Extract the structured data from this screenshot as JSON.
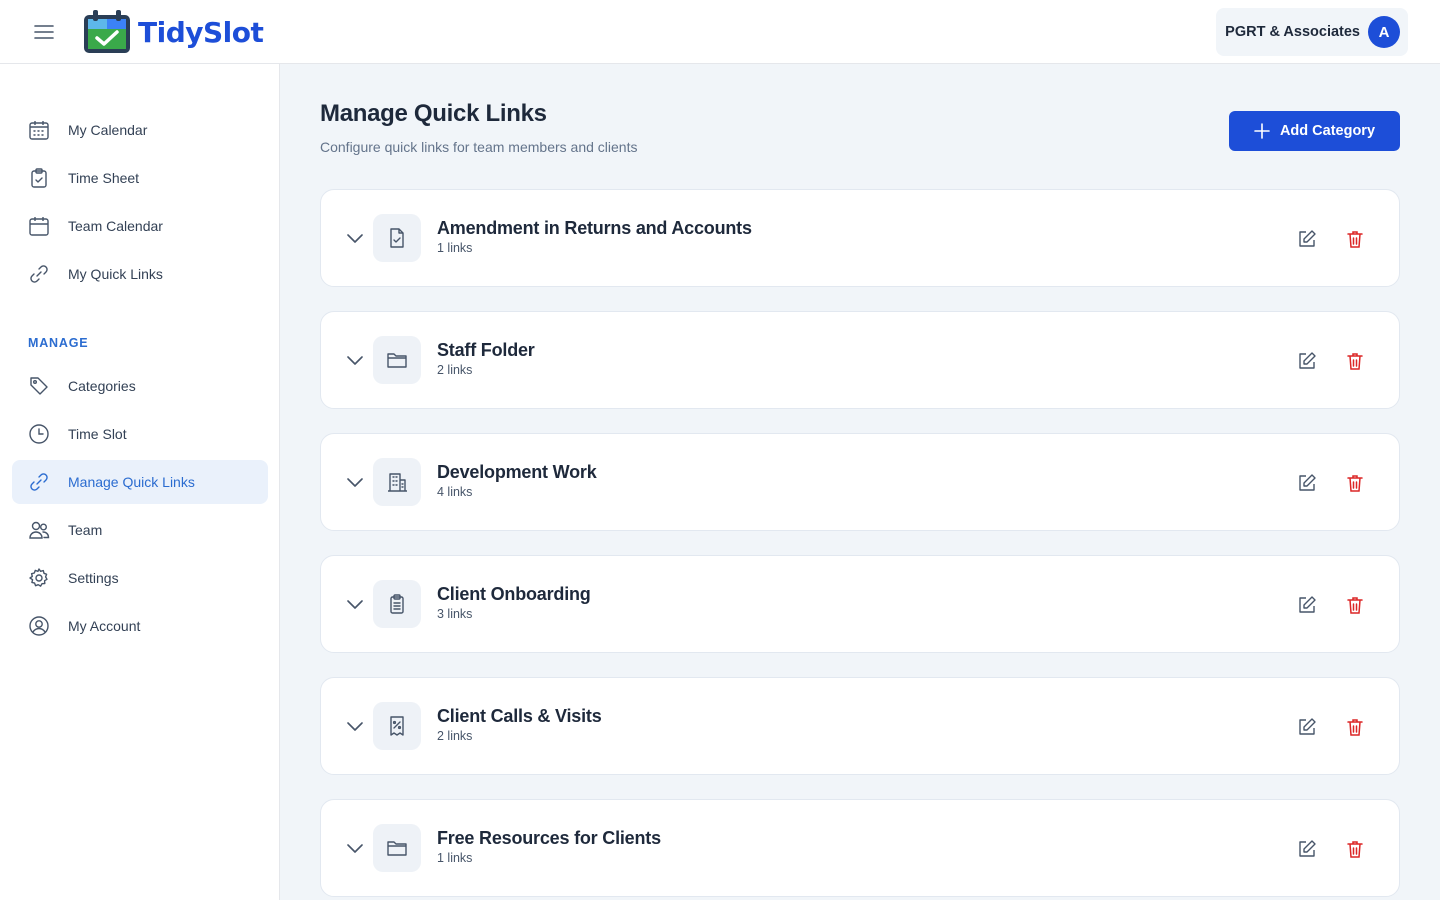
{
  "header": {
    "app_name": "TidySlot",
    "organization": "PGRT & Associates",
    "avatar_initial": "A",
    "brand_color": "#1d4ed8"
  },
  "sidebar": {
    "items": [
      {
        "label": "My Calendar",
        "icon": "calendar-grid-icon"
      },
      {
        "label": "Time Sheet",
        "icon": "clipboard-check-icon"
      },
      {
        "label": "Team Calendar",
        "icon": "calendar-icon"
      },
      {
        "label": "My Quick Links",
        "icon": "link-icon"
      }
    ],
    "manage_label": "MANAGE",
    "manage_items": [
      {
        "label": "Categories",
        "icon": "tag-icon"
      },
      {
        "label": "Time Slot",
        "icon": "clock-icon"
      },
      {
        "label": "Manage Quick Links",
        "icon": "link-icon",
        "active": true
      },
      {
        "label": "Team",
        "icon": "users-icon"
      },
      {
        "label": "Settings",
        "icon": "gear-icon"
      },
      {
        "label": "My Account",
        "icon": "user-circle-icon"
      }
    ]
  },
  "main": {
    "title": "Manage Quick Links",
    "subtitle": "Configure quick links for team members and clients",
    "add_button_label": "Add Category",
    "categories": [
      {
        "name": "Amendment in Returns and Accounts",
        "count": "1 links",
        "icon": "file-check-icon"
      },
      {
        "name": "Staff Folder",
        "count": "2 links",
        "icon": "folder-icon"
      },
      {
        "name": "Development Work",
        "count": "4 links",
        "icon": "building-icon"
      },
      {
        "name": "Client Onboarding",
        "count": "3 links",
        "icon": "clipboard-list-icon"
      },
      {
        "name": "Client Calls & Visits",
        "count": "2 links",
        "icon": "receipt-percent-icon"
      },
      {
        "name": "Free Resources for Clients",
        "count": "1 links",
        "icon": "folder-icon"
      }
    ]
  },
  "colors": {
    "accent": "#2b6cd0",
    "delete": "#dc2626",
    "active_bg": "#eaf1fb"
  }
}
